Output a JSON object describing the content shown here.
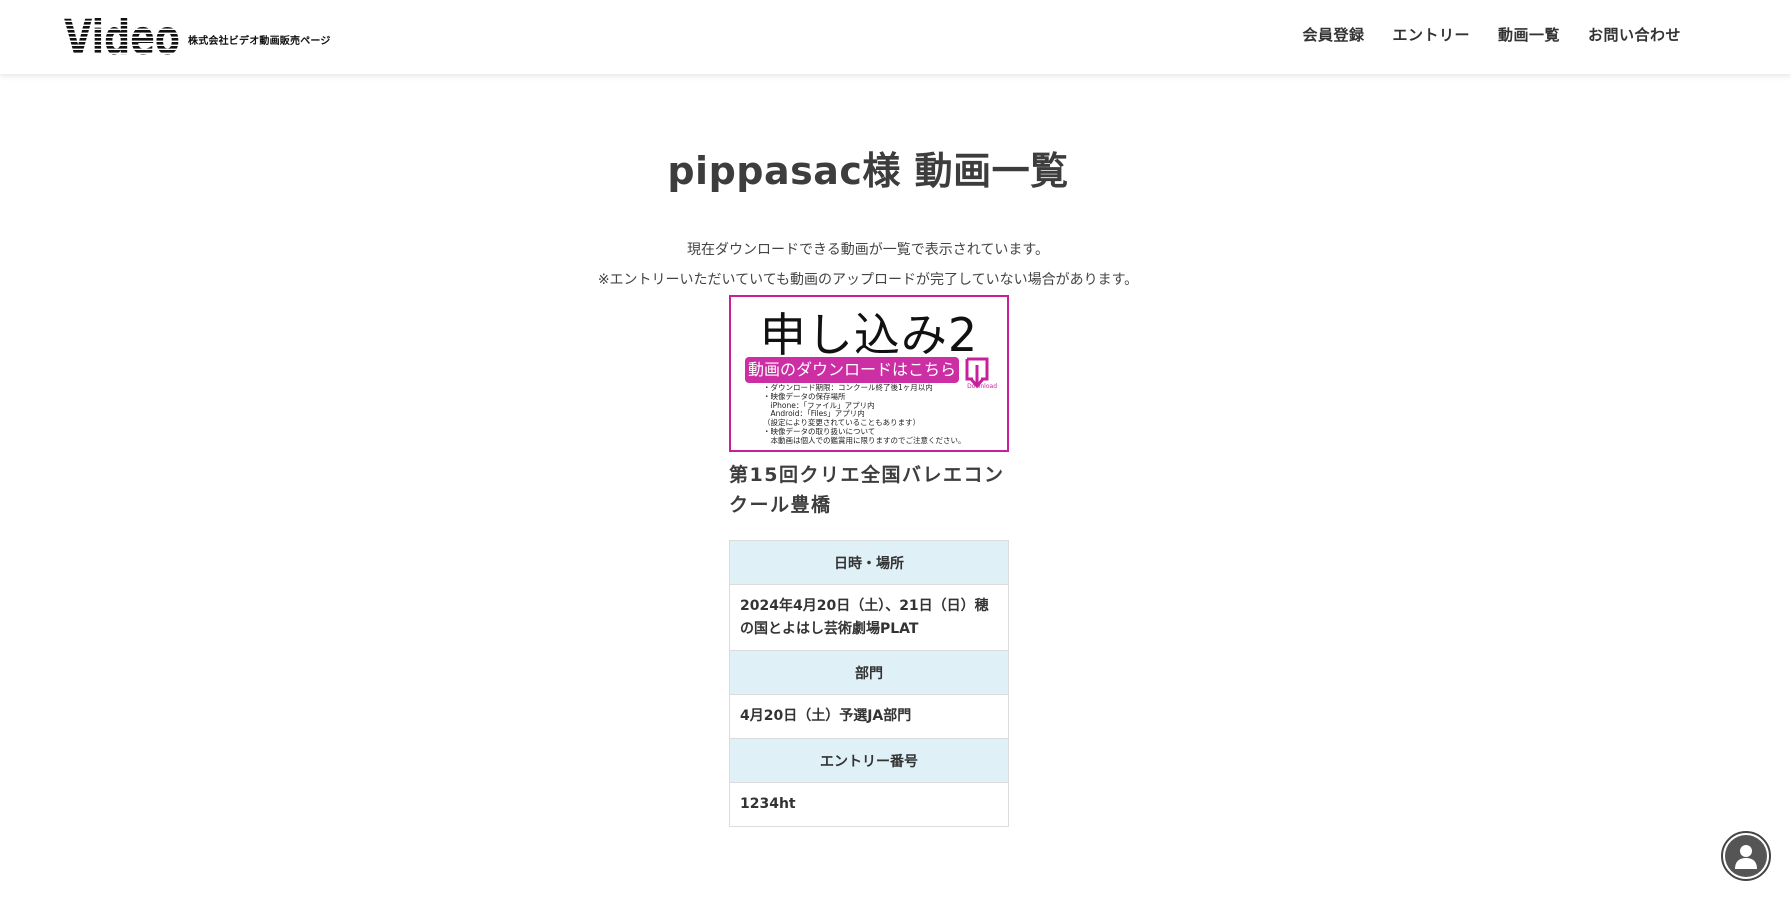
{
  "header": {
    "logo_text": "Video",
    "logo_subtitle": "株式会社ビデオ動画販売ページ",
    "nav": [
      {
        "label": "会員登録"
      },
      {
        "label": "エントリー"
      },
      {
        "label": "動画一覧"
      },
      {
        "label": "お問い合わせ"
      }
    ]
  },
  "main": {
    "title": "pippasac様 動画一覧",
    "intro_line1": "現在ダウンロードできる動画が一覧で表示されています。",
    "intro_line2": "※エントリーいただいていても動画のアップロードが完了していない場合があります。"
  },
  "video": {
    "thumbnail": {
      "heading": "申し込み2",
      "download_bar": "動画のダウンロードはこちら",
      "download_icon_label": "Download",
      "notes": [
        "・ダウンロード期限：コンクール終了後1ヶ月以内",
        "・映像データの保存場所",
        "　iPhone：「ファイル」アプリ内",
        "　Android：「Files」アプリ内",
        "（設定により変更されていることもあります）",
        "・映像データの取り扱いについて",
        "　本動画は個人での鑑賞用に限りますのでご注意ください。"
      ]
    },
    "title": "第15回クリエ全国バレエコンクール豊橋",
    "table": {
      "datetime_header": "日時・場所",
      "datetime_value": "2024年4月20日（土）、21日（日）穂の国とよはし芸術劇場PLAT",
      "division_header": "部門",
      "division_value": "4月20日（土）予選JA部門",
      "entry_header": "エントリー番号",
      "entry_value": "1234ht"
    }
  },
  "floating": {
    "user_icon": "user-icon"
  },
  "colors": {
    "accent_magenta": "#c81f9c",
    "table_header_bg": "#e0f0f7",
    "text": "#3d3d3d"
  }
}
